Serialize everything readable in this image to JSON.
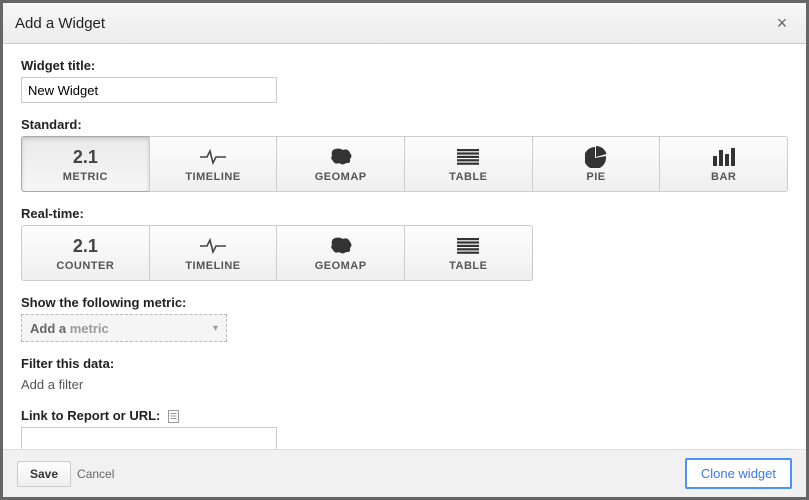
{
  "header": {
    "title": "Add a Widget"
  },
  "widgetTitle": {
    "label": "Widget title:",
    "value": "New Widget"
  },
  "standard": {
    "label": "Standard:",
    "tiles": [
      {
        "icon_text": "2.1",
        "label": "METRIC"
      },
      {
        "label": "TIMELINE"
      },
      {
        "label": "GEOMAP"
      },
      {
        "label": "TABLE"
      },
      {
        "label": "PIE"
      },
      {
        "label": "BAR"
      }
    ]
  },
  "realtime": {
    "label": "Real-time:",
    "tiles": [
      {
        "icon_text": "2.1",
        "label": "COUNTER"
      },
      {
        "label": "TIMELINE"
      },
      {
        "label": "GEOMAP"
      },
      {
        "label": "TABLE"
      }
    ]
  },
  "metricSection": {
    "label": "Show the following metric:",
    "add_prefix": "Add a ",
    "add_word": "metric"
  },
  "filterSection": {
    "label": "Filter this data:",
    "add": "Add a filter"
  },
  "linkSection": {
    "label": "Link to Report or URL:",
    "value": ""
  },
  "footer": {
    "save": "Save",
    "cancel": "Cancel",
    "clone": "Clone widget"
  }
}
